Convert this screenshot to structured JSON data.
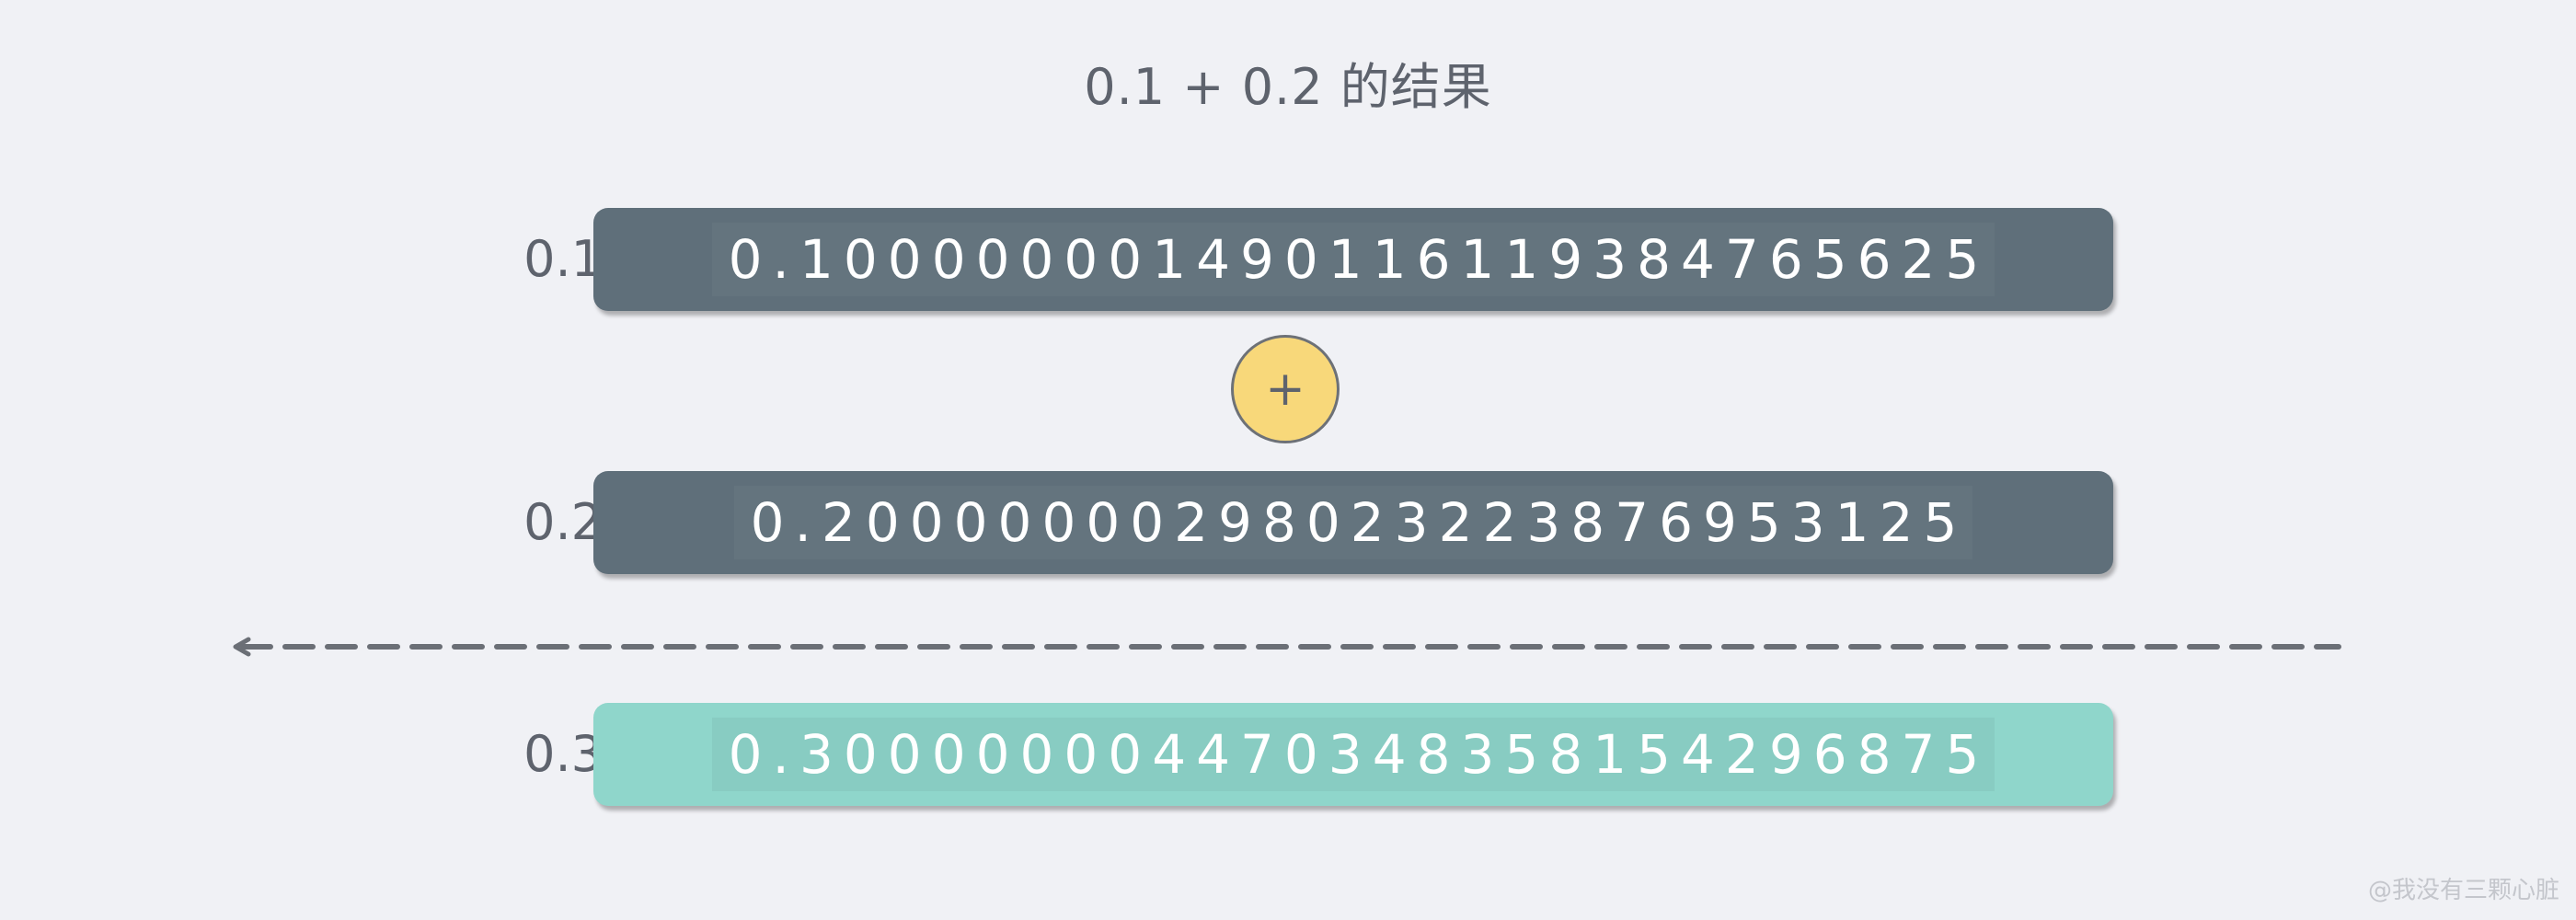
{
  "title": "0.1 + 0.2 的结果",
  "rows": [
    {
      "label": "0.1",
      "value": "0.100000001490116119384765625",
      "color": "#5f6f7a"
    },
    {
      "label": "0.2",
      "value": "0.20000000298023223876953125",
      "color": "#5f6f7a"
    },
    {
      "label": "0.3",
      "value": "0.300000004470348358154296875",
      "color": "#8fd6cb"
    }
  ],
  "operator": "+",
  "operator_color": "#f8d87a",
  "watermark": "@我没有三颗心脏"
}
